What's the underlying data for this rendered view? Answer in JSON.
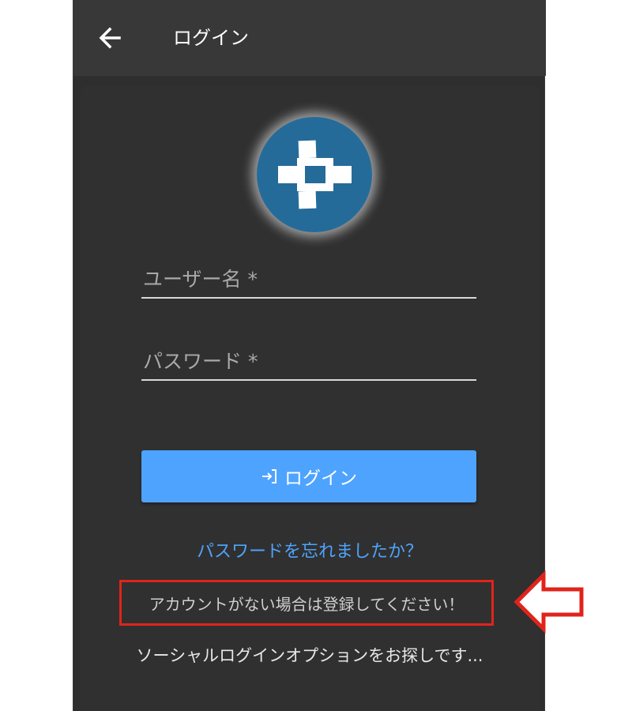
{
  "appbar": {
    "back_icon": "arrow-left-icon",
    "title": "ログイン"
  },
  "logo": {
    "icon": "dpad-cross-icon",
    "color": "#256b9a"
  },
  "form": {
    "username_placeholder": "ユーザー名 *",
    "username_value": "",
    "password_placeholder": "パスワード *",
    "password_value": ""
  },
  "login_button": {
    "icon": "login-enter-icon",
    "label": "ログイン",
    "color": "#4ea3ff"
  },
  "links": {
    "forgot_password": "パスワードを忘れましたか？",
    "register": "アカウントがない場合は登録してください！",
    "social_login": "ソーシャルログインオプションをお探しです..."
  },
  "annotation": {
    "highlight_color": "#e0241b",
    "arrow_icon": "red-outline-left-arrow-icon"
  }
}
